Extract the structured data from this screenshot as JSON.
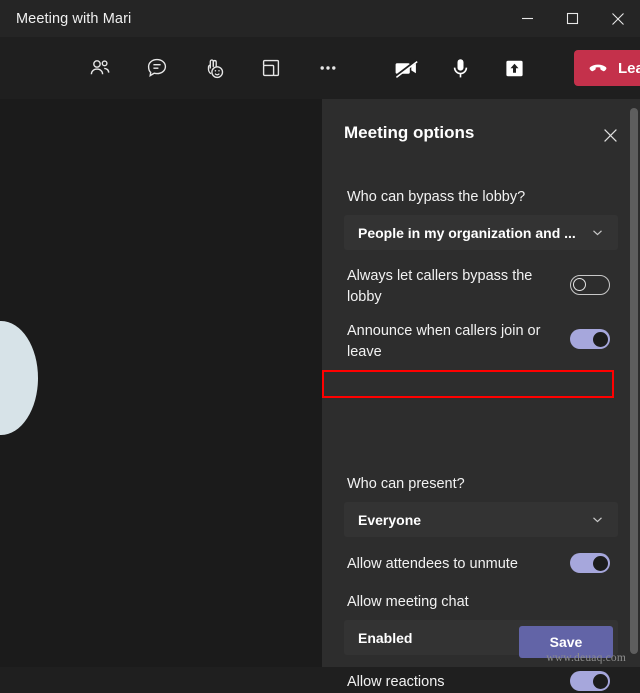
{
  "window": {
    "title": "Meeting with Mari",
    "controls": {
      "minimize": "minimize-icon",
      "maximize": "maximize-icon",
      "close": "close-icon"
    }
  },
  "toolbar": {
    "left_items": [
      {
        "name": "people-icon",
        "label": "People"
      },
      {
        "name": "chat-icon",
        "label": "Chat"
      },
      {
        "name": "raise-hand-reactions-icon",
        "label": "Reactions"
      },
      {
        "name": "breakout-rooms-icon",
        "label": "Rooms"
      },
      {
        "name": "more-options-icon",
        "label": "More actions"
      }
    ],
    "right_items": [
      {
        "name": "camera-off-icon",
        "label": "Camera off"
      },
      {
        "name": "microphone-icon",
        "label": "Mic"
      },
      {
        "name": "share-screen-icon",
        "label": "Share"
      }
    ],
    "leave_label": "Leave",
    "leave_caret": "chevron-down-icon",
    "leave_color": "#c4314b"
  },
  "panel": {
    "title": "Meeting options",
    "close_icon": "close-icon",
    "options": [
      {
        "id": "bypass_lobby",
        "label": "Who can bypass the lobby?",
        "control": "dropdown",
        "value": "People in my organization and ..."
      },
      {
        "id": "always_callers_bypass",
        "label": "Always let callers bypass the lobby",
        "control": "toggle",
        "value": "off"
      },
      {
        "id": "announce_callers",
        "label": "Announce when callers join or leave",
        "control": "toggle",
        "value": "on"
      },
      {
        "id": "who_can_present",
        "label": "Who can present?",
        "control": "dropdown",
        "value": "Everyone",
        "highlighted": true
      },
      {
        "id": "allow_unmute",
        "label": "Allow attendees to unmute",
        "control": "toggle",
        "value": "on"
      },
      {
        "id": "allow_meeting_chat",
        "label": "Allow meeting chat",
        "control": "dropdown",
        "value": "Enabled"
      },
      {
        "id": "allow_reactions",
        "label": "Allow reactions",
        "control": "toggle",
        "value": "on"
      }
    ],
    "save_label": "Save",
    "save_color": "#6264a7",
    "highlight_color": "#ff0000"
  },
  "watermark": "www.deuaq.com"
}
